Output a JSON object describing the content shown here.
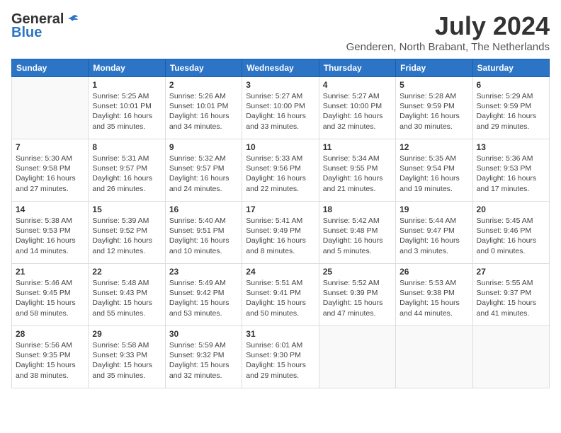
{
  "header": {
    "logo_general": "General",
    "logo_blue": "Blue",
    "month_year": "July 2024",
    "location": "Genderen, North Brabant, The Netherlands"
  },
  "days_of_week": [
    "Sunday",
    "Monday",
    "Tuesday",
    "Wednesday",
    "Thursday",
    "Friday",
    "Saturday"
  ],
  "weeks": [
    [
      {
        "day": "",
        "info": ""
      },
      {
        "day": "1",
        "info": "Sunrise: 5:25 AM\nSunset: 10:01 PM\nDaylight: 16 hours\nand 35 minutes."
      },
      {
        "day": "2",
        "info": "Sunrise: 5:26 AM\nSunset: 10:01 PM\nDaylight: 16 hours\nand 34 minutes."
      },
      {
        "day": "3",
        "info": "Sunrise: 5:27 AM\nSunset: 10:00 PM\nDaylight: 16 hours\nand 33 minutes."
      },
      {
        "day": "4",
        "info": "Sunrise: 5:27 AM\nSunset: 10:00 PM\nDaylight: 16 hours\nand 32 minutes."
      },
      {
        "day": "5",
        "info": "Sunrise: 5:28 AM\nSunset: 9:59 PM\nDaylight: 16 hours\nand 30 minutes."
      },
      {
        "day": "6",
        "info": "Sunrise: 5:29 AM\nSunset: 9:59 PM\nDaylight: 16 hours\nand 29 minutes."
      }
    ],
    [
      {
        "day": "7",
        "info": "Sunrise: 5:30 AM\nSunset: 9:58 PM\nDaylight: 16 hours\nand 27 minutes."
      },
      {
        "day": "8",
        "info": "Sunrise: 5:31 AM\nSunset: 9:57 PM\nDaylight: 16 hours\nand 26 minutes."
      },
      {
        "day": "9",
        "info": "Sunrise: 5:32 AM\nSunset: 9:57 PM\nDaylight: 16 hours\nand 24 minutes."
      },
      {
        "day": "10",
        "info": "Sunrise: 5:33 AM\nSunset: 9:56 PM\nDaylight: 16 hours\nand 22 minutes."
      },
      {
        "day": "11",
        "info": "Sunrise: 5:34 AM\nSunset: 9:55 PM\nDaylight: 16 hours\nand 21 minutes."
      },
      {
        "day": "12",
        "info": "Sunrise: 5:35 AM\nSunset: 9:54 PM\nDaylight: 16 hours\nand 19 minutes."
      },
      {
        "day": "13",
        "info": "Sunrise: 5:36 AM\nSunset: 9:53 PM\nDaylight: 16 hours\nand 17 minutes."
      }
    ],
    [
      {
        "day": "14",
        "info": "Sunrise: 5:38 AM\nSunset: 9:53 PM\nDaylight: 16 hours\nand 14 minutes."
      },
      {
        "day": "15",
        "info": "Sunrise: 5:39 AM\nSunset: 9:52 PM\nDaylight: 16 hours\nand 12 minutes."
      },
      {
        "day": "16",
        "info": "Sunrise: 5:40 AM\nSunset: 9:51 PM\nDaylight: 16 hours\nand 10 minutes."
      },
      {
        "day": "17",
        "info": "Sunrise: 5:41 AM\nSunset: 9:49 PM\nDaylight: 16 hours\nand 8 minutes."
      },
      {
        "day": "18",
        "info": "Sunrise: 5:42 AM\nSunset: 9:48 PM\nDaylight: 16 hours\nand 5 minutes."
      },
      {
        "day": "19",
        "info": "Sunrise: 5:44 AM\nSunset: 9:47 PM\nDaylight: 16 hours\nand 3 minutes."
      },
      {
        "day": "20",
        "info": "Sunrise: 5:45 AM\nSunset: 9:46 PM\nDaylight: 16 hours\nand 0 minutes."
      }
    ],
    [
      {
        "day": "21",
        "info": "Sunrise: 5:46 AM\nSunset: 9:45 PM\nDaylight: 15 hours\nand 58 minutes."
      },
      {
        "day": "22",
        "info": "Sunrise: 5:48 AM\nSunset: 9:43 PM\nDaylight: 15 hours\nand 55 minutes."
      },
      {
        "day": "23",
        "info": "Sunrise: 5:49 AM\nSunset: 9:42 PM\nDaylight: 15 hours\nand 53 minutes."
      },
      {
        "day": "24",
        "info": "Sunrise: 5:51 AM\nSunset: 9:41 PM\nDaylight: 15 hours\nand 50 minutes."
      },
      {
        "day": "25",
        "info": "Sunrise: 5:52 AM\nSunset: 9:39 PM\nDaylight: 15 hours\nand 47 minutes."
      },
      {
        "day": "26",
        "info": "Sunrise: 5:53 AM\nSunset: 9:38 PM\nDaylight: 15 hours\nand 44 minutes."
      },
      {
        "day": "27",
        "info": "Sunrise: 5:55 AM\nSunset: 9:37 PM\nDaylight: 15 hours\nand 41 minutes."
      }
    ],
    [
      {
        "day": "28",
        "info": "Sunrise: 5:56 AM\nSunset: 9:35 PM\nDaylight: 15 hours\nand 38 minutes."
      },
      {
        "day": "29",
        "info": "Sunrise: 5:58 AM\nSunset: 9:33 PM\nDaylight: 15 hours\nand 35 minutes."
      },
      {
        "day": "30",
        "info": "Sunrise: 5:59 AM\nSunset: 9:32 PM\nDaylight: 15 hours\nand 32 minutes."
      },
      {
        "day": "31",
        "info": "Sunrise: 6:01 AM\nSunset: 9:30 PM\nDaylight: 15 hours\nand 29 minutes."
      },
      {
        "day": "",
        "info": ""
      },
      {
        "day": "",
        "info": ""
      },
      {
        "day": "",
        "info": ""
      }
    ]
  ]
}
